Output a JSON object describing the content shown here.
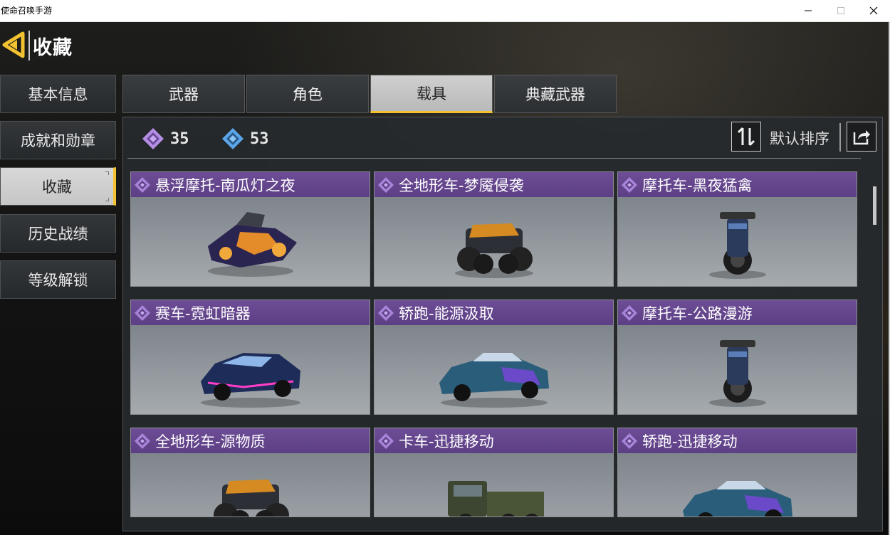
{
  "window": {
    "title": "使命召唤手游"
  },
  "header": {
    "title": "收藏"
  },
  "nav": {
    "items": [
      {
        "label": "基本信息"
      },
      {
        "label": "成就和勋章"
      },
      {
        "label": "收藏"
      },
      {
        "label": "历史战绩"
      },
      {
        "label": "等级解锁"
      }
    ],
    "active_index": 2
  },
  "tabs": {
    "items": [
      {
        "label": "武器"
      },
      {
        "label": "角色"
      },
      {
        "label": "载具"
      },
      {
        "label": "典藏武器"
      }
    ],
    "active_index": 2
  },
  "stats": {
    "purple_count": "35",
    "blue_count": "53"
  },
  "toolbar": {
    "sort_label": "默认排序"
  },
  "cards": [
    {
      "title": "悬浮摩托-南瓜灯之夜",
      "icon": "hover-bike"
    },
    {
      "title": "全地形车-梦魇侵袭",
      "icon": "atv"
    },
    {
      "title": "摩托车-黑夜猛禽",
      "icon": "motorcycle"
    },
    {
      "title": "赛车-霓虹暗器",
      "icon": "race-car"
    },
    {
      "title": "轿跑-能源汲取",
      "icon": "sports-car"
    },
    {
      "title": "摩托车-公路漫游",
      "icon": "motorcycle"
    },
    {
      "title": "全地形车-源物质",
      "icon": "atv"
    },
    {
      "title": "卡车-迅捷移动",
      "icon": "truck"
    },
    {
      "title": "轿跑-迅捷移动",
      "icon": "sports-car"
    }
  ],
  "colors": {
    "accent": "#f2c230",
    "rarity_purple": "#5d3f85",
    "diamond_purple": "#b68ee6",
    "diamond_blue": "#5aa6e8"
  }
}
